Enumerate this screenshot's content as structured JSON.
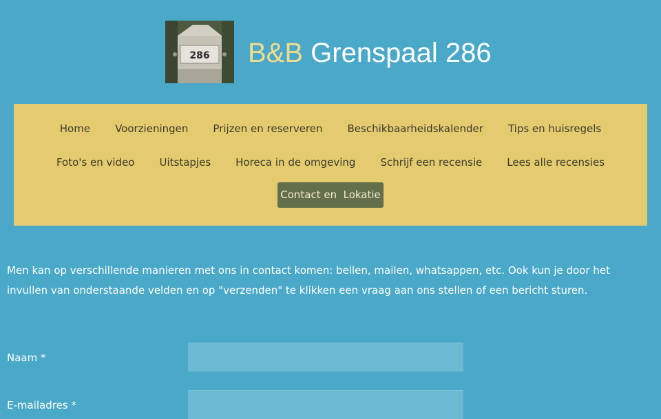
{
  "header": {
    "title_prefix": "B&B",
    "title_name": "Grenspaal 286",
    "logo_text": "286"
  },
  "nav": {
    "row1": [
      "Home",
      "Voorzieningen",
      "Prijzen en reserveren",
      "Beschikbaarheidskalender",
      "Tips en huisregels"
    ],
    "row2": [
      "Foto's en video",
      "Uitstapjes",
      "Horeca in de omgeving",
      "Schrijf een recensie",
      "Lees alle recensies"
    ],
    "active": "Contact en  Lokatie"
  },
  "content": {
    "intro": "Men kan op verschillende manieren met ons in contact komen: bellen, mailen, whatsappen, etc. Ook kun je door het invullen van onderstaande velden en op \"verzenden\" te klikken een vraag aan ons stellen of een bericht sturen."
  },
  "form": {
    "name_label": "Naam *",
    "name_value": "",
    "email_label": "E-mailadres *",
    "email_value": ""
  },
  "colors": {
    "background": "#4aa8c8",
    "nav_background": "#e4cb6f",
    "active_button": "#636e4a",
    "title_accent": "#f0dd8e"
  }
}
